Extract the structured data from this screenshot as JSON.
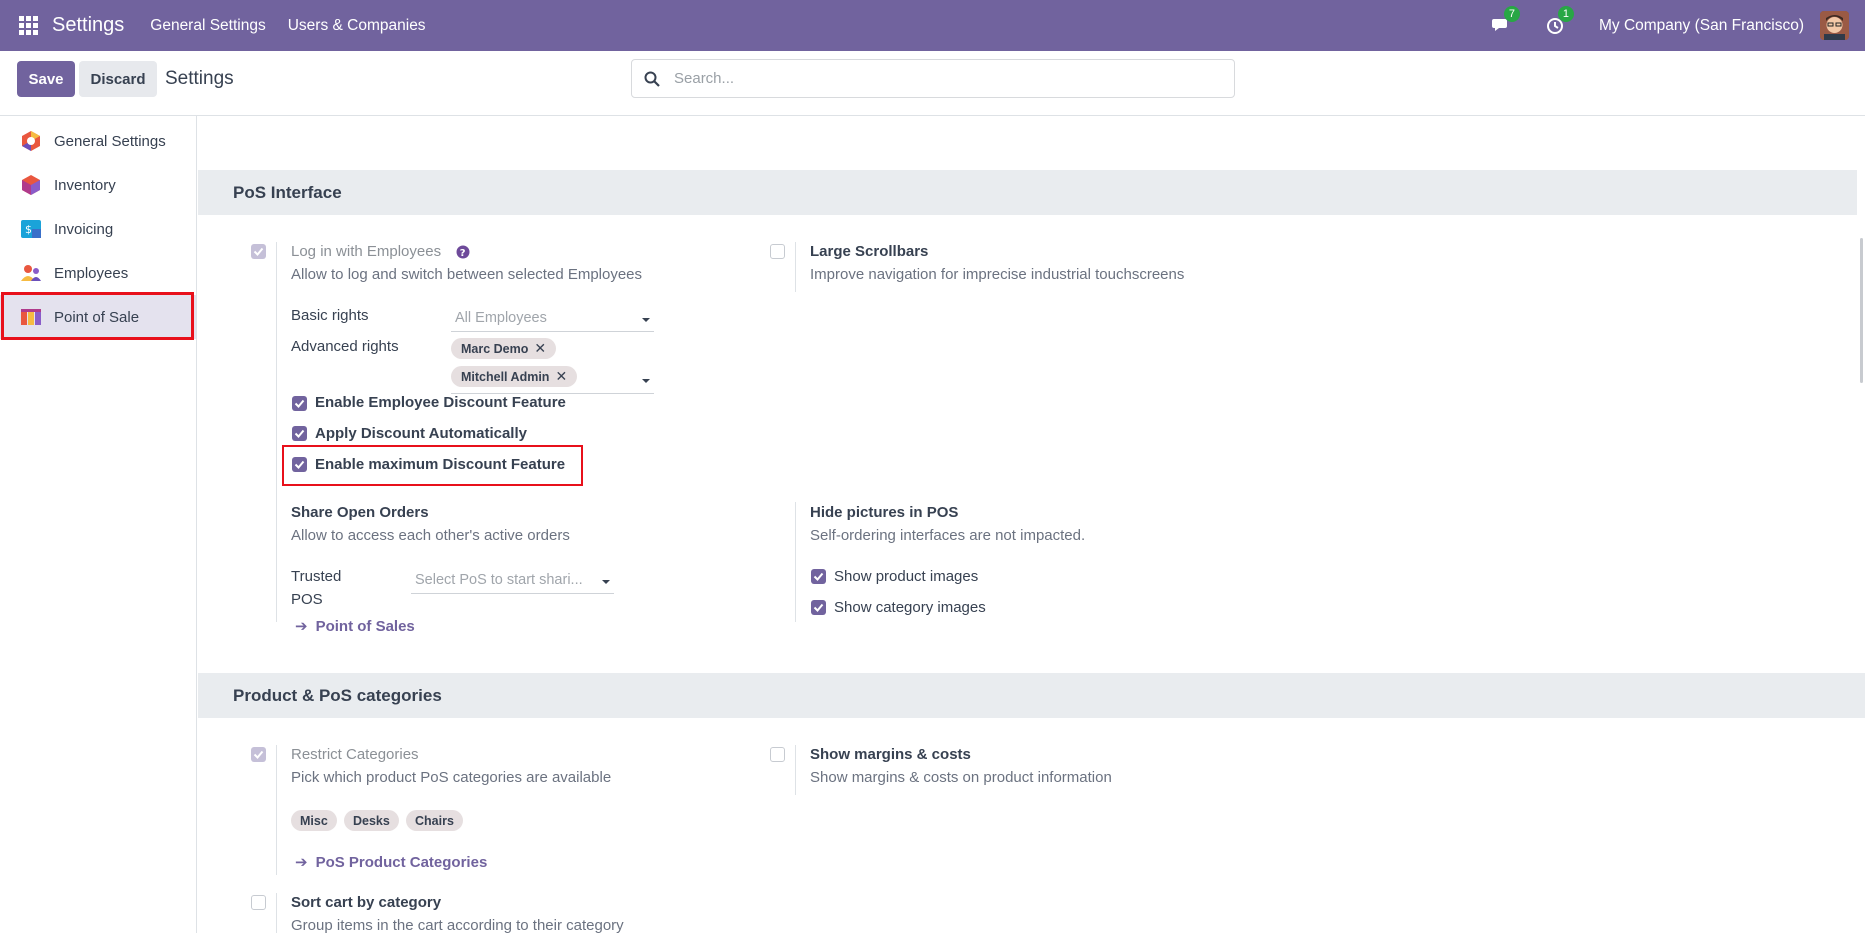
{
  "navbar": {
    "brand": "Settings",
    "menus": [
      "General Settings",
      "Users & Companies"
    ],
    "messages_count": "7",
    "activities_count": "1",
    "company": "My Company (San Francisco)"
  },
  "control": {
    "save_label": "Save",
    "discard_label": "Discard",
    "title": "Settings",
    "search_placeholder": "Search..."
  },
  "sidebar": {
    "items": [
      {
        "label": "General Settings",
        "icon": "general-settings-icon"
      },
      {
        "label": "Inventory",
        "icon": "inventory-icon"
      },
      {
        "label": "Invoicing",
        "icon": "invoicing-icon"
      },
      {
        "label": "Employees",
        "icon": "employees-icon"
      },
      {
        "label": "Point of Sale",
        "icon": "point-of-sale-icon",
        "active": true
      }
    ]
  },
  "pos_interface": {
    "title": "PoS Interface",
    "login_employees": {
      "label": "Log in with Employees",
      "desc": "Allow to log and switch between selected Employees",
      "checked": true
    },
    "basic_rights": {
      "label": "Basic rights",
      "placeholder": "All Employees"
    },
    "advanced_rights": {
      "label": "Advanced rights",
      "tags": [
        "Marc Demo",
        "Mitchell Admin"
      ]
    },
    "employee_discount": {
      "label": "Enable Employee Discount Feature",
      "checked": true
    },
    "apply_discount": {
      "label": "Apply Discount Automatically",
      "checked": true
    },
    "max_discount": {
      "label": "Enable maximum Discount Feature",
      "checked": true
    },
    "large_scrollbars": {
      "label": "Large Scrollbars",
      "desc": "Improve navigation for imprecise industrial touchscreens",
      "checked": false
    },
    "share_orders": {
      "label": "Share Open Orders",
      "desc": "Allow to access each other's active orders"
    },
    "trusted_pos": {
      "label_line1": "Trusted",
      "label_line2": "POS",
      "placeholder": "Select PoS to start shari..."
    },
    "point_of_sales_link": "Point of Sales",
    "hide_pictures": {
      "label": "Hide pictures in POS",
      "desc": "Self-ordering interfaces are not impacted."
    },
    "show_product_images": {
      "label": "Show product images",
      "checked": true
    },
    "show_category_images": {
      "label": "Show category images",
      "checked": true
    }
  },
  "product_categories": {
    "title": "Product & PoS categories",
    "restrict": {
      "label": "Restrict Categories",
      "desc": "Pick which product PoS categories are available",
      "checked": true
    },
    "tags": [
      "Misc",
      "Desks",
      "Chairs"
    ],
    "categories_link": "PoS Product Categories",
    "margins": {
      "label": "Show margins & costs",
      "desc": "Show margins & costs on product information",
      "checked": false
    },
    "sort_cart": {
      "label": "Sort cart by category",
      "desc": "Group items in the cart according to their category",
      "checked": false
    }
  },
  "colors": {
    "brand": "#71639e",
    "highlight": "#e8101b",
    "badge": "#28a745"
  }
}
